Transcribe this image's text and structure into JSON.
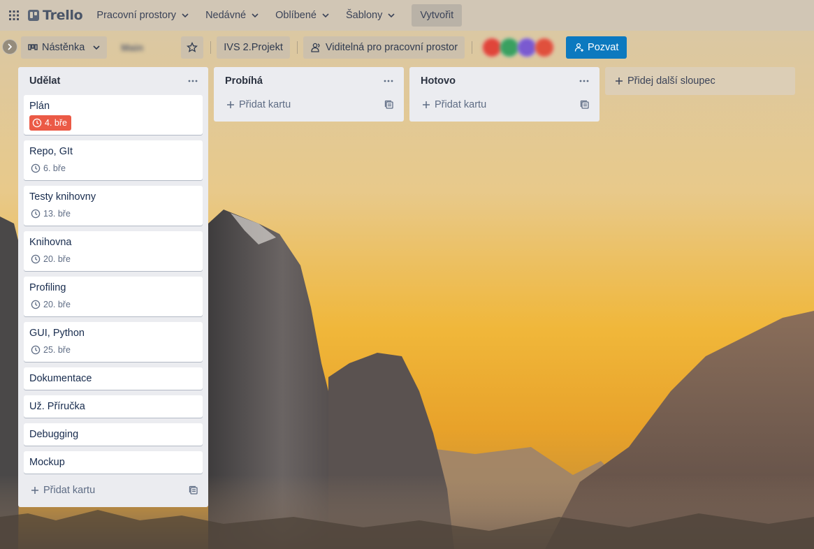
{
  "colors": {
    "overdue": "#eb5a46",
    "invite": "#0c79bf",
    "list_bg": "#ebecf0"
  },
  "topbar": {
    "apps_icon": "grid-icon",
    "logo": "Trello",
    "nav": [
      {
        "label": "Pracovní prostory"
      },
      {
        "label": "Nedávné"
      },
      {
        "label": "Oblíbené"
      },
      {
        "label": "Šablony"
      }
    ],
    "create_label": "Vytvořit"
  },
  "board_header": {
    "view_label": "Nástěnka",
    "board_name": "Main",
    "workspace_label": "IVS 2.Projekt",
    "visibility_label": "Viditelná pro pracovní prostor",
    "invite_label": "Pozvat"
  },
  "lists": [
    {
      "title": "Udělat",
      "cards": [
        {
          "title": "Plán",
          "due": "4. bře",
          "overdue": true
        },
        {
          "title": "Repo, GIt",
          "due": "6. bře"
        },
        {
          "title": "Testy knihovny",
          "due": "13. bře"
        },
        {
          "title": "Knihovna",
          "due": "20. bře"
        },
        {
          "title": "Profiling",
          "due": "20. bře"
        },
        {
          "title": "GUI, Python",
          "due": "25. bře"
        },
        {
          "title": "Dokumentace"
        },
        {
          "title": "Už. Příručka"
        },
        {
          "title": "Debugging"
        },
        {
          "title": "Mockup"
        }
      ],
      "add_label": "Přidat kartu"
    },
    {
      "title": "Probíhá",
      "cards": [],
      "add_label": "Přidat kartu"
    },
    {
      "title": "Hotovo",
      "cards": [],
      "add_label": "Přidat kartu"
    }
  ],
  "add_list_label": "Přidej další sloupec"
}
